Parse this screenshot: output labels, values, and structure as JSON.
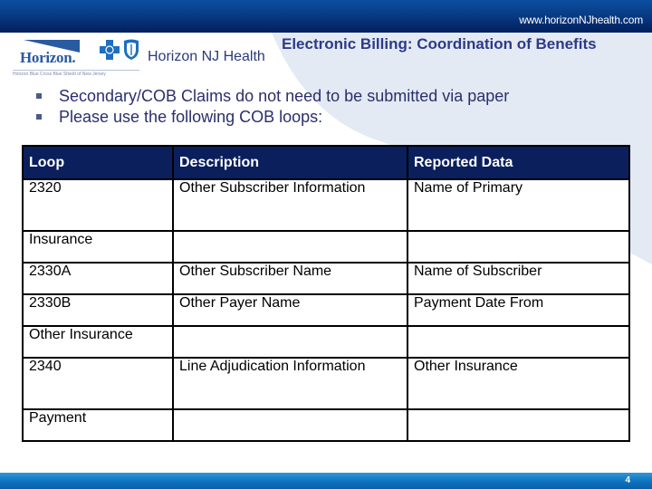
{
  "header": {
    "url": "www.horizonNJhealth.com",
    "logo": {
      "wordmark": "Horizon.",
      "tagline": "Horizon Blue Cross Blue Shield of New Jersey",
      "icons": [
        "blue-cross-icon",
        "blue-shield-icon"
      ]
    },
    "brand_name": "Horizon NJ Health",
    "title": "Electronic Billing: Coordination of Benefits"
  },
  "bullets": [
    "Secondary/COB Claims do not need to be submitted via paper",
    "Please use the following COB loops:"
  ],
  "table": {
    "headers": [
      "Loop",
      "Description",
      "Reported Data"
    ],
    "rows": [
      [
        "2320",
        "Other Subscriber Information",
        "Name of Primary"
      ],
      [
        "Insurance",
        "",
        ""
      ],
      [
        "2330A",
        "Other Subscriber Name",
        "Name of Subscriber"
      ],
      [
        "2330B",
        "Other Payer Name",
        "Payment Date From"
      ],
      [
        "Other Insurance",
        "",
        ""
      ],
      [
        "2340",
        "Line  Adjudication Information",
        "Other Insurance"
      ],
      [
        "Payment",
        "",
        ""
      ]
    ]
  },
  "footer": {
    "page_number": "4"
  },
  "colors": {
    "header_bar": "#083c85",
    "title_text": "#2e3a87",
    "table_header_bg": "#0a1f5c",
    "footer_bar": "#0d73bf",
    "swoosh": "#e3eaf4"
  }
}
